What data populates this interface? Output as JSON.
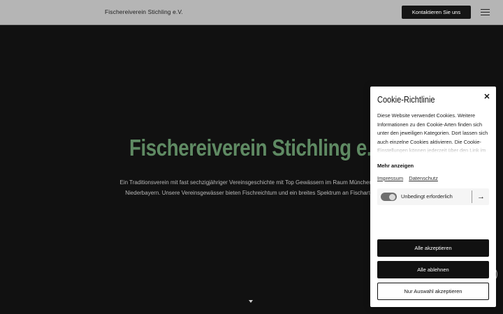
{
  "header": {
    "site_name": "Fischereiverein Stichling e.V.",
    "contact_label": "Kontaktieren Sie uns",
    "menu_icon": "hamburger-icon"
  },
  "hero": {
    "title": "Fischereiverein Stichling e.V.",
    "text": "Ein Traditionsverein mit fast sechzigjähriger Vereinsgeschichte mit Top Gewässern im Raum München und Niederbayern. Unsere Vereinsgewässer bieten Fischreichtum und ein breites Spektrum an Fischarten.",
    "scroll_icon": "caret-down-icon"
  },
  "cookie": {
    "title": "Cookie-Richtlinie",
    "close_icon": "close-icon",
    "description": "Diese Website verwendet Cookies. Weitere Informationen zu den Cookie-Arten finden sich unter den jeweiligen Kategorien. Dort lassen sich auch einzelne Cookies aktivieren. Die Cookie-Einstellungen können jederzeit über den Link im",
    "more_label": "Mehr anzeigen",
    "links": [
      "Impressum",
      "Datenschutz"
    ],
    "necessary_label": "Unbedingt erforderlich",
    "necessary_enabled": true,
    "buttons": {
      "accept_all": "Alle akzeptieren",
      "reject_all": "Alle ablehnen",
      "accept_selection": "Nur Auswahl akzeptieren"
    }
  },
  "colors": {
    "header_bg": "#b5b5b5",
    "hero_bg": "#111111",
    "title_green": "#5f8a63",
    "button_dark": "#111111"
  }
}
